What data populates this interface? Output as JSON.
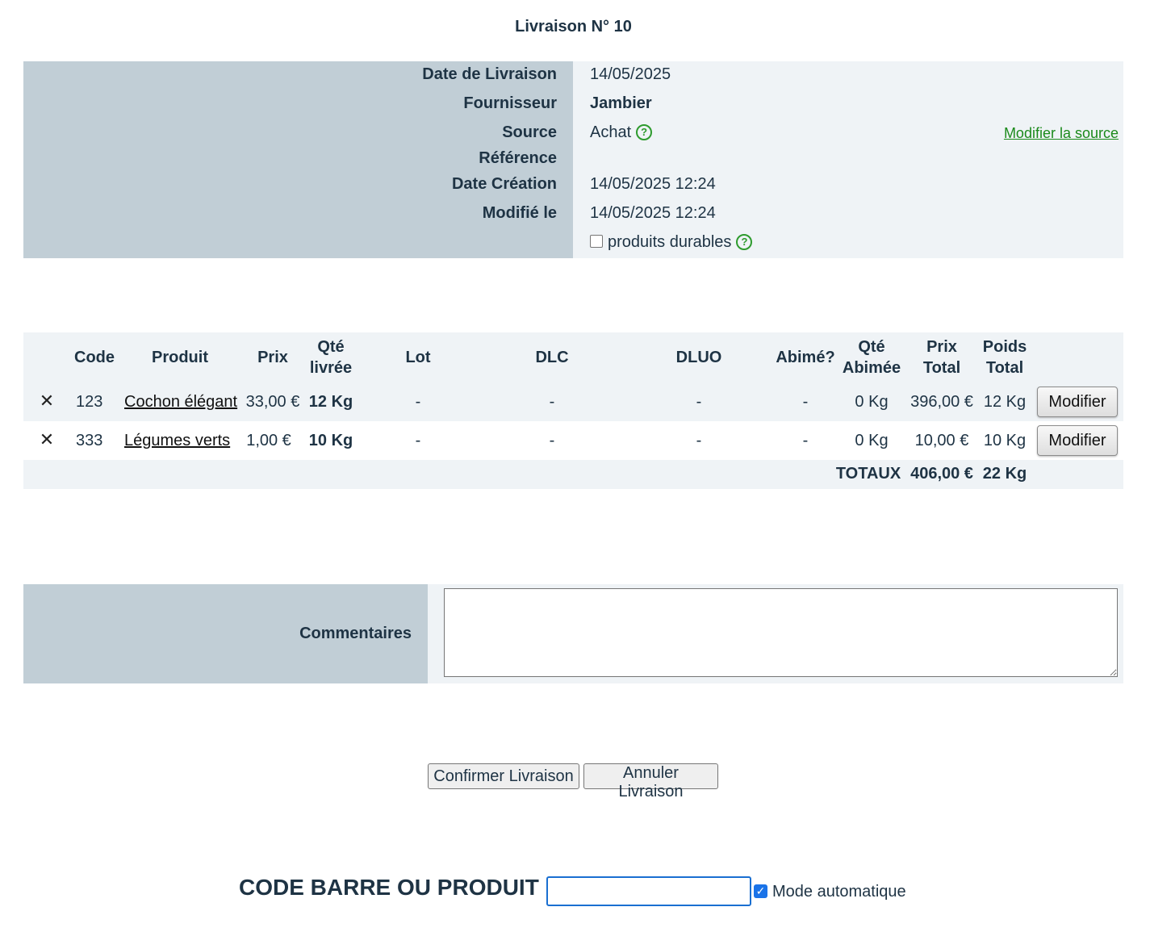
{
  "title": "Livraison N° 10",
  "info": {
    "rows": [
      {
        "label": "Date de Livraison",
        "value": "14/05/2025"
      },
      {
        "label": "Fournisseur",
        "value": "Jambier"
      },
      {
        "label": "Source",
        "value": "Achat"
      },
      {
        "label": "Référence",
        "value": ""
      },
      {
        "label": "Date Création",
        "value": "14/05/2025 12:24"
      },
      {
        "label": "Modifié le",
        "value": "14/05/2025 12:24"
      }
    ],
    "modify_source_link": "Modifier la source",
    "durable_label": "produits durables",
    "help_glyph": "?"
  },
  "table": {
    "headers": {
      "code": "Code",
      "produit": "Produit",
      "prix": "Prix",
      "qte_livree_1": "Qté",
      "qte_livree_2": "livrée",
      "lot": "Lot",
      "dlc": "DLC",
      "dluo": "DLUO",
      "abime": "Abimé?",
      "qte_abimee_1": "Qté",
      "qte_abimee_2": "Abimée",
      "prix_total_1": "Prix",
      "prix_total_2": "Total",
      "poids_total_1": "Poids",
      "poids_total_2": "Total"
    },
    "rows": [
      {
        "delete": "✕",
        "code": "123",
        "produit": "Cochon élégant",
        "prix": "33,00 €",
        "qte": "12 Kg",
        "lot": "-",
        "dlc": "-",
        "dluo": "-",
        "abime": "-",
        "qte_abimee": "0 Kg",
        "prix_total": "396,00 €",
        "poids_total": "12 Kg",
        "button": "Modifier"
      },
      {
        "delete": "✕",
        "code": "333",
        "produit": "Légumes verts",
        "prix": "1,00 €",
        "qte": "10 Kg",
        "lot": "-",
        "dlc": "-",
        "dluo": "-",
        "abime": "-",
        "qte_abimee": "0 Kg",
        "prix_total": "10,00 €",
        "poids_total": "10 Kg",
        "button": "Modifier"
      }
    ],
    "totals": {
      "label": "TOTAUX",
      "prix": "406,00 €",
      "poids": "22 Kg"
    }
  },
  "comments": {
    "label": "Commentaires",
    "value": ""
  },
  "actions": {
    "confirm": "Confirmer Livraison",
    "cancel": "Annuler Livraison"
  },
  "barcode": {
    "label": "CODE BARRE OU PRODUIT :",
    "value": "",
    "auto_label": "Mode automatique",
    "auto_checked": true,
    "check_glyph": "✓"
  }
}
